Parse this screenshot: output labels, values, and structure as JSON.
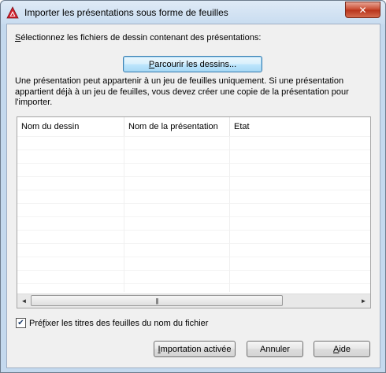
{
  "window": {
    "title": "Importer les présentations sous forme de feuilles",
    "close_symbol": "✕"
  },
  "main": {
    "select_label_prefix": "",
    "select_label_u": "S",
    "select_label_rest": "électionnez les fichiers de dessin contenant des présentations:",
    "browse_button_u": "P",
    "browse_button_rest": "arcourir les dessins...",
    "info_text": "Une présentation peut appartenir à un jeu de feuilles uniquement. Si une présentation appartient déjà à un jeu de feuilles, vous devez créer une copie de la présentation pour l'importer."
  },
  "list": {
    "columns": [
      "Nom du dessin",
      "Nom de la présentation",
      "Etat"
    ],
    "rows": []
  },
  "scrollbar": {
    "left_arrow": "◄",
    "right_arrow": "►",
    "thumb_grip": "|||"
  },
  "options": {
    "prefix_checked": true,
    "check_mark": "✔",
    "prefix_label_a": "Pré",
    "prefix_label_u": "f",
    "prefix_label_rest": "ixer les titres des feuilles du nom du fichier"
  },
  "buttons": {
    "import_u": "I",
    "import_rest": "mportation activée",
    "cancel": "Annuler",
    "help_u": "A",
    "help_rest": "ide"
  },
  "colors": {
    "title_bar": "#c8dcf0",
    "close_button": "#c7472b",
    "dialog_bg": "#f0f0f0",
    "app_icon": "#d21f2b"
  }
}
